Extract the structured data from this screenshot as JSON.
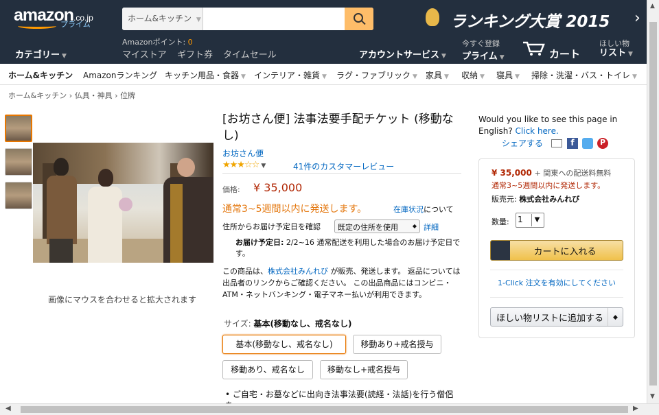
{
  "header": {
    "logo": "amazon",
    "logo_tld": ".co.jp",
    "logo_sub": "プライム",
    "search_dept": "ホーム&キッチン",
    "search_placeholder": "",
    "banner": "ランキング大賞 2015",
    "points_label": "Amazonポイント:",
    "points_value": "0",
    "links": [
      "マイストア",
      "ギフト券",
      "タイムセール"
    ],
    "category": "カテゴリー",
    "account": "アカウントサービス",
    "prime_small": "今すぐ登録",
    "prime": "プライム",
    "cart": "カート",
    "wish_small": "ほしい物",
    "wish": "リスト"
  },
  "subnav": [
    "ホーム&キッチン",
    "Amazonランキング",
    "キッチン用品・食器",
    "インテリア・雑貨",
    "ラグ・ファブリック",
    "家具",
    "収納",
    "寝具",
    "掃除・洗濯・バス・トイレ"
  ],
  "breadcrumb": [
    "ホーム&キッチン",
    "仏具・神具",
    "位牌"
  ],
  "image": {
    "hover_note": "画像にマウスを合わせると拡大されます"
  },
  "product": {
    "title": "[お坊さん便] 法事法要手配チケット (移動なし)",
    "brand": "お坊さん便",
    "stars": "★★★☆☆",
    "rating": 3,
    "reviews": "41件のカスタマーレビュー",
    "price_label": "価格:",
    "price": "¥ 35,000",
    "ship_time": "通常3~5週間以内に発送します。",
    "stock_link": "在庫状況",
    "stock_suffix": "について",
    "addr_label": "住所からお届け予定日を確認",
    "addr_select": "既定の住所を使用",
    "detail": "詳細",
    "delivery_label": "お届け予定日:",
    "delivery_text": "2/2~16 通常配送を利用した場合のお届け予定日です。",
    "sold_prefix": "この商品は、",
    "sold_seller": "株式会社みんれび",
    "sold_text": "が販売、発送します。 返品については出品者のリンクからご確認ください。 この出品商品にはコンビニ・ATM・ネットバンキング・電子マネー払いが利用できます。",
    "size_label": "サイズ:",
    "size_value": "基本(移動なし、戒名なし)",
    "options": [
      "基本(移動なし、戒名なし)",
      "移動あり+戒名授与",
      "移動あり、戒名なし",
      "移動なし+戒名授与"
    ],
    "bullet": "ご自宅・お墓などに出向き法事法要(読経・法話)を行う僧侶を"
  },
  "side": {
    "english_q": "Would you like to see this page in English?",
    "english_link": "Click here.",
    "share": "シェアする",
    "bb_price": "¥ 35,000",
    "bb_ship_free": "+ 関東への配送料無料",
    "bb_ship_time": "通常3~5週間以内に発送します。",
    "bb_seller_label": "販売元:",
    "bb_seller": "株式会社みんれび",
    "qty_label": "数量:",
    "qty": "1",
    "cart_button": "カートに入れる",
    "oneclick": "1-Click 注文を有効にしてください",
    "wish_button": "ほしい物リストに追加する"
  }
}
